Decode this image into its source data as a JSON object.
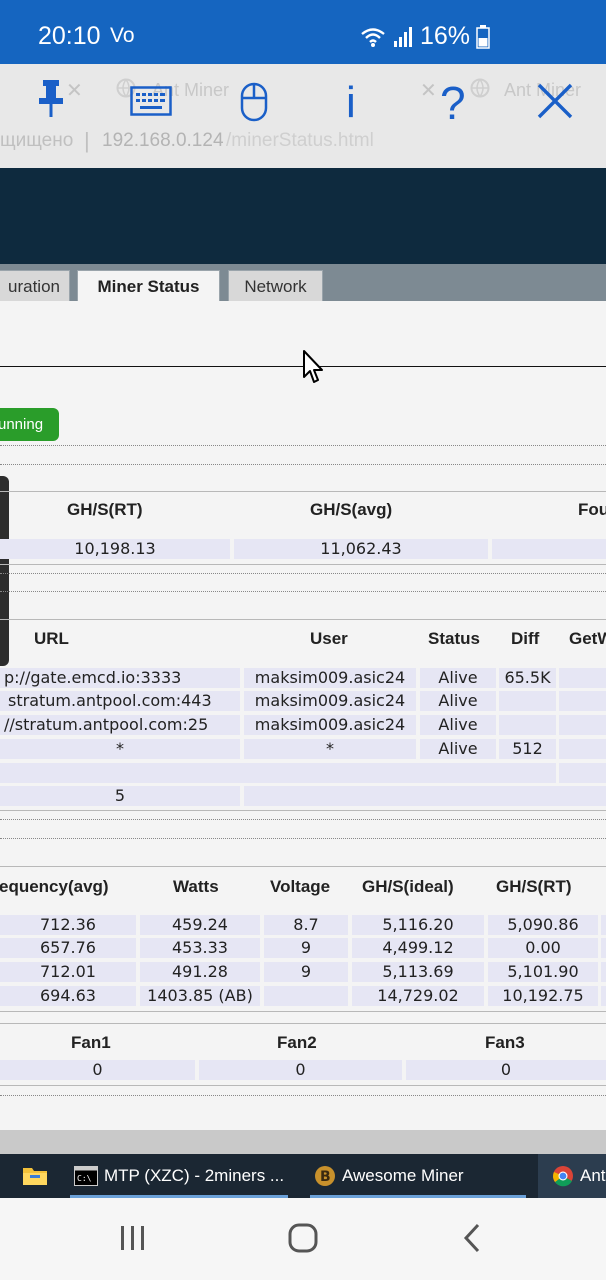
{
  "status_bar": {
    "time": "20:10",
    "volte": "Vo",
    "battery": "16%"
  },
  "browser": {
    "tabs": [
      {
        "title": "Ant Miner"
      },
      {
        "title": "Ant Miner"
      }
    ],
    "url_prefix": "щищено",
    "url_host": "192.168.0.124",
    "url_path": "/minerStatus.html"
  },
  "remote_toolbar": [
    {
      "name": "pin",
      "glyph": "pin-icon"
    },
    {
      "name": "keyboard",
      "glyph": "keyboard-icon"
    },
    {
      "name": "mouse",
      "glyph": "mouse-icon"
    },
    {
      "name": "info",
      "glyph": "info-icon",
      "label": "i"
    },
    {
      "name": "help",
      "glyph": "help-icon",
      "label": "?"
    },
    {
      "name": "close",
      "glyph": "close-icon"
    }
  ],
  "nav_tabs": [
    {
      "label": "uration",
      "active": false
    },
    {
      "label": "Miner Status",
      "active": true
    },
    {
      "label": "Network",
      "active": false
    }
  ],
  "status_badge": "unning",
  "summary": {
    "headers": [
      "GH/S(RT)",
      "GH/S(avg)",
      "Fou"
    ],
    "row": [
      "10,198.13",
      "11,062.43",
      ""
    ]
  },
  "pools": {
    "headers": [
      "URL",
      "User",
      "Status",
      "Diff",
      "GetW"
    ],
    "rows": [
      [
        "p://gate.emcd.io:3333",
        "maksim009.asic24",
        "Alive",
        "65.5K",
        ""
      ],
      [
        "stratum.antpool.com:443",
        "maksim009.asic24",
        "Alive",
        "",
        ""
      ],
      [
        "//stratum.antpool.com:25",
        "maksim009.asic24",
        "Alive",
        "",
        ""
      ],
      [
        "*",
        "*",
        "Alive",
        "512",
        ""
      ],
      [
        "",
        "",
        "",
        "",
        ""
      ]
    ],
    "total": "5"
  },
  "chains": {
    "headers": [
      "equency(avg)",
      "Watts",
      "Voltage",
      "GH/S(ideal)",
      "GH/S(RT)"
    ],
    "rows": [
      [
        "712.36",
        "459.24",
        "8.7",
        "5,116.20",
        "5,090.86"
      ],
      [
        "657.76",
        "453.33",
        "9",
        "4,499.12",
        "0.00"
      ],
      [
        "712.01",
        "491.28",
        "9",
        "5,113.69",
        "5,101.90"
      ],
      [
        "694.63",
        "1403.85 (AB)",
        "",
        "14,729.02",
        "10,192.75"
      ]
    ]
  },
  "fans": {
    "headers": [
      "Fan1",
      "Fan2",
      "Fan3"
    ],
    "row": [
      "0",
      "0",
      "0"
    ]
  },
  "taskbar": [
    {
      "label": "MTP (XZC) - 2miners ...",
      "icon": "terminal-icon"
    },
    {
      "label": "Awesome Miner",
      "icon": "bitcoin-icon"
    },
    {
      "label": "Ant",
      "icon": "chrome-icon"
    }
  ]
}
